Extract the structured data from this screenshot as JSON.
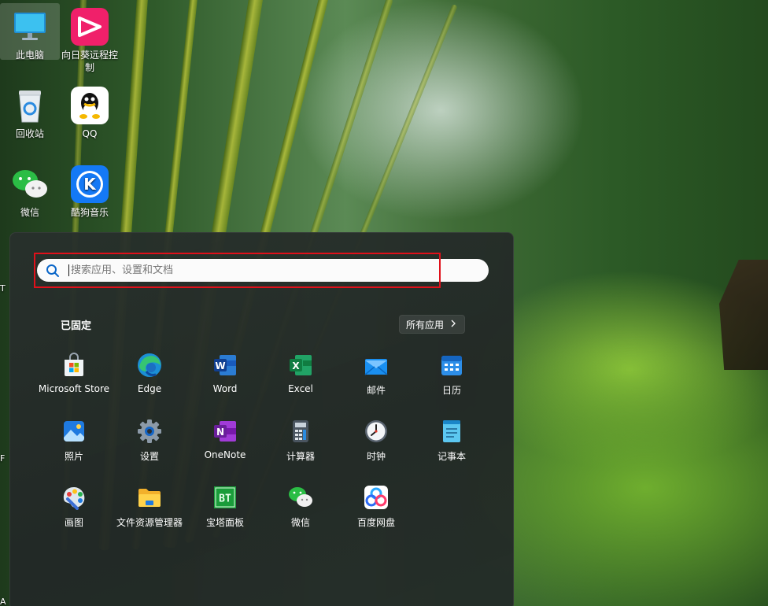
{
  "desktop": {
    "icons": [
      {
        "label": "此电脑"
      },
      {
        "label": "向日葵远程控制"
      },
      {
        "label": "回收站"
      },
      {
        "label": "QQ"
      },
      {
        "label": "微信"
      },
      {
        "label": "酷狗音乐"
      }
    ],
    "edge_fragments": [
      "T",
      "F",
      "A"
    ]
  },
  "start_menu": {
    "search": {
      "placeholder": "搜索应用、设置和文档"
    },
    "pinned_title": "已固定",
    "all_apps_label": "所有应用",
    "apps": [
      {
        "label": "Microsoft Store",
        "icon": "microsoft-store-icon"
      },
      {
        "label": "Edge",
        "icon": "edge-icon"
      },
      {
        "label": "Word",
        "icon": "word-icon"
      },
      {
        "label": "Excel",
        "icon": "excel-icon"
      },
      {
        "label": "邮件",
        "icon": "mail-icon"
      },
      {
        "label": "日历",
        "icon": "calendar-icon"
      },
      {
        "label": "照片",
        "icon": "photos-icon"
      },
      {
        "label": "设置",
        "icon": "settings-gear-icon"
      },
      {
        "label": "OneNote",
        "icon": "onenote-icon"
      },
      {
        "label": "计算器",
        "icon": "calculator-icon"
      },
      {
        "label": "时钟",
        "icon": "clock-icon"
      },
      {
        "label": "记事本",
        "icon": "notepad-icon"
      },
      {
        "label": "画图",
        "icon": "paint-icon"
      },
      {
        "label": "文件资源管理器",
        "icon": "file-explorer-icon"
      },
      {
        "label": "宝塔面板",
        "icon": "bt-panel-icon"
      },
      {
        "label": "微信",
        "icon": "wechat-icon"
      },
      {
        "label": "百度网盘",
        "icon": "baidu-netdisk-icon"
      }
    ]
  },
  "icon_text": {
    "bt": "BT",
    "k": "K",
    "n": "N",
    "w": "W",
    "x": "X"
  },
  "colors": {
    "highlight": "#e0101a",
    "accent": "#0a66c8"
  }
}
